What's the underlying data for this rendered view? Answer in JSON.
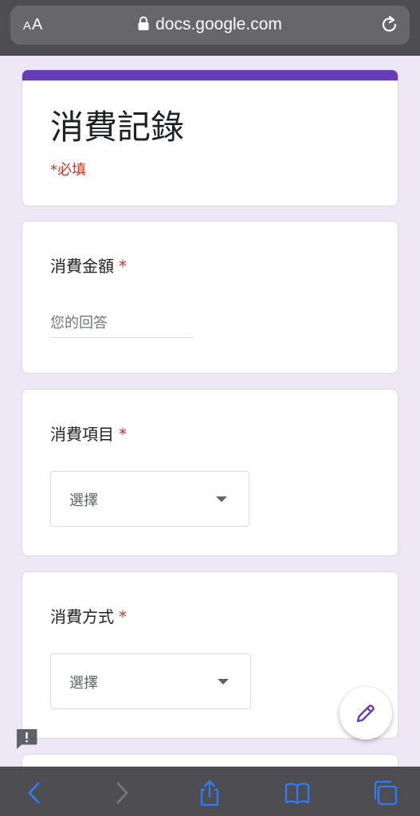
{
  "browser": {
    "text_size_label": "AA",
    "url": "docs.google.com"
  },
  "form": {
    "title": "消費記錄",
    "required_note": "*必填"
  },
  "questions": [
    {
      "title": "消費金額",
      "required_mark": "*",
      "type": "short_answer",
      "placeholder": "您的回答"
    },
    {
      "title": "消費項目",
      "required_mark": "*",
      "type": "dropdown",
      "selected_label": "選擇"
    },
    {
      "title": "消費方式",
      "required_mark": "*",
      "type": "dropdown",
      "selected_label": "選擇"
    }
  ],
  "colors": {
    "accent": "#673ab7",
    "required": "#d93025",
    "page_background": "#ede7f6",
    "browser_chrome": "#4e4d52",
    "toolbar_icon": "#2f7cf6"
  },
  "icons": [
    "lock-icon",
    "reload-icon",
    "chevron-down-icon",
    "pencil-icon",
    "feedback-icon",
    "back-icon",
    "forward-icon",
    "share-icon",
    "bookmarks-icon",
    "tabs-icon"
  ]
}
